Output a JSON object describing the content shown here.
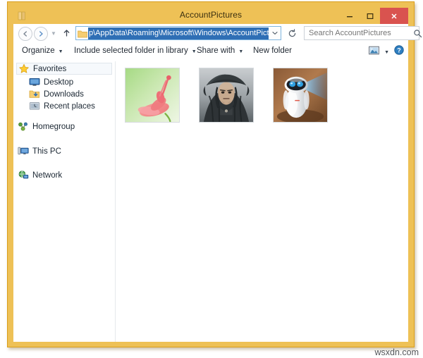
{
  "window": {
    "title": "AccountPictures",
    "icon": "folder-window-icon",
    "frame_color": "#eec156",
    "accent_color": "#eeb42c",
    "controls": {
      "minimize": "–",
      "maximize": "□",
      "close": "×",
      "close_color": "#d9534f"
    }
  },
  "navigation": {
    "back": "←",
    "forward": "→",
    "history_dropdown": "▼",
    "up": "↑",
    "address": {
      "value": "p\\AppData\\Roaming\\Microsoft\\Windows\\AccountPictu",
      "selected": true,
      "dropdown": "⌄",
      "folder_icon": "folder-icon"
    },
    "refresh": "↻",
    "search": {
      "placeholder": "Search AccountPictures",
      "value": "",
      "icon": "search-icon"
    }
  },
  "toolbar": {
    "items": [
      {
        "label": "Organize",
        "has_caret": true
      },
      {
        "label": "Include selected folder in library",
        "has_caret": true
      },
      {
        "label": "Share with",
        "has_caret": true
      },
      {
        "label": "New folder",
        "has_caret": false
      }
    ],
    "view_icon": "view-mode-icon",
    "view_caret": "▼",
    "help_icon": "help-icon"
  },
  "sidebar": {
    "items": [
      {
        "label": "Favorites",
        "icon": "star-icon",
        "indent": false,
        "selected": true
      },
      {
        "label": "Desktop",
        "icon": "desktop-icon",
        "indent": true,
        "selected": false
      },
      {
        "label": "Downloads",
        "icon": "downloads-icon",
        "indent": true,
        "selected": false
      },
      {
        "label": "Recent places",
        "icon": "recent-places-icon",
        "indent": true,
        "selected": false
      },
      {
        "label": "Homegroup",
        "icon": "homegroup-icon",
        "indent": false,
        "selected": false
      },
      {
        "label": "This PC",
        "icon": "this-pc-icon",
        "indent": false,
        "selected": false
      },
      {
        "label": "Network",
        "icon": "network-icon",
        "indent": false,
        "selected": false
      }
    ]
  },
  "content": {
    "thumbnails": [
      {
        "name": "flower-picture",
        "description": "Pink flower on green background"
      },
      {
        "name": "pirate-picture",
        "description": "Pirate portrait with tricorn hat"
      },
      {
        "name": "robot-eve-picture",
        "description": "White robot with blue light beam"
      }
    ]
  },
  "watermark": {
    "text": "wsxdn.com"
  }
}
